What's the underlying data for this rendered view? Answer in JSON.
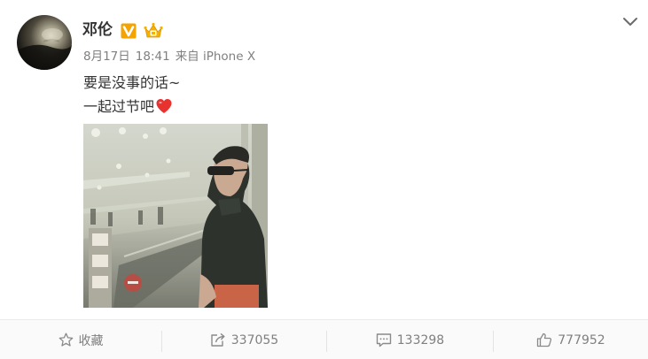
{
  "user": {
    "name": "邓伦",
    "verified_badge": "V"
  },
  "post": {
    "date": "8月17日",
    "time": "18:41",
    "source": "来自 iPhone X",
    "text_line1": "要是没事的话~",
    "text_line2": "一起过节吧"
  },
  "actions": {
    "favorite_label": "收藏",
    "repost_count": "337055",
    "comment_count": "133298",
    "like_count": "777952"
  },
  "icons": {
    "avatar": "avatar-image",
    "verified": "verified-v-icon",
    "member": "crown-member-icon",
    "heart": "red-heart-emoji",
    "menu": "chevron-down-icon",
    "favorite": "star-icon",
    "repost": "share-arrow-icon",
    "comment": "comment-bubble-icon",
    "like": "thumbs-up-icon"
  },
  "colors": {
    "verified_orange": "#f5a300",
    "heart_red": "#e8322f",
    "text_primary": "#333333",
    "text_meta": "#808080"
  }
}
